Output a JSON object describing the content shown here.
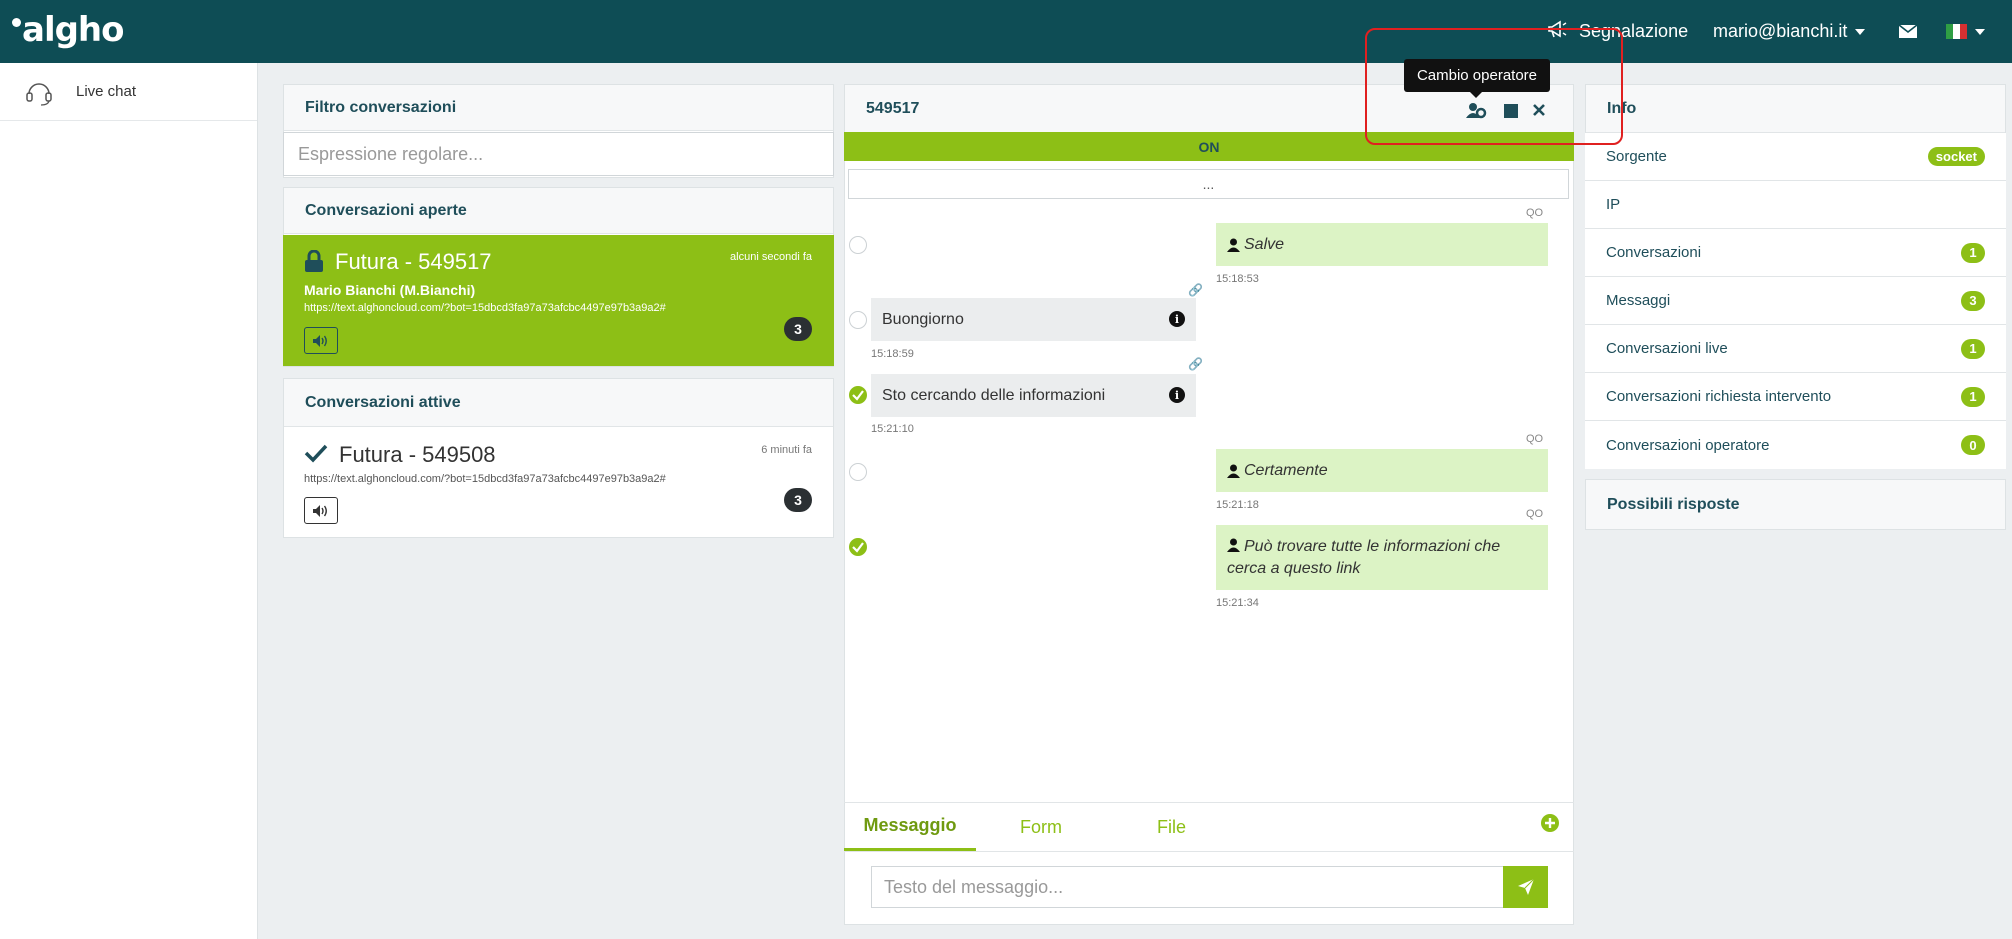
{
  "topbar": {
    "logo": "algho",
    "report_label": "Segnalazione",
    "user_email": "mario@bianchi.it"
  },
  "sidebar": {
    "items": [
      {
        "label": "Live chat",
        "icon": "headset-icon"
      }
    ]
  },
  "filter": {
    "title": "Filtro conversazioni",
    "placeholder": "Espressione regolare..."
  },
  "open_conversations": {
    "title": "Conversazioni aperte",
    "items": [
      {
        "title": "Futura  - 549517",
        "time": "alcuni secondi fa",
        "user": "Mario Bianchi (M.Bianchi)",
        "url": "https://text.alghoncloud.com/?bot=15dbcd3fa97a73afcbc4497e97b3a9a2#",
        "count": "3"
      }
    ]
  },
  "active_conversations": {
    "title": "Conversazioni attive",
    "items": [
      {
        "title": "Futura  - 549508",
        "time": "6 minuti fa",
        "url": "https://text.alghoncloud.com/?bot=15dbcd3fa97a73afcbc4497e97b3a9a2#",
        "count": "3"
      }
    ]
  },
  "chat": {
    "id": "549517",
    "status": "ON",
    "more": "...",
    "tooltip": "Cambio operatore",
    "messages": [
      {
        "side": "operator",
        "sender": "QO",
        "text": "Salve",
        "time": "15:18:53",
        "checked": false
      },
      {
        "side": "user",
        "text": "Buongiorno",
        "time": "15:18:59",
        "checked": false
      },
      {
        "side": "user",
        "text": "Sto cercando delle informazioni",
        "time": "15:21:10",
        "checked": true
      },
      {
        "side": "operator",
        "sender": "QO",
        "text": "Certamente",
        "time": "15:21:18",
        "checked": false
      },
      {
        "side": "operator",
        "sender": "QO",
        "text": "Può trovare tutte le informazioni che cerca a questo link",
        "time": "15:21:34",
        "checked": true
      }
    ],
    "tabs": [
      "Messaggio",
      "Form",
      "File"
    ],
    "active_tab": "Messaggio",
    "input_placeholder": "Testo del messaggio..."
  },
  "info": {
    "title": "Info",
    "rows": [
      {
        "label": "Sorgente",
        "value": "socket"
      },
      {
        "label": "IP",
        "value": ""
      },
      {
        "label": "Conversazioni",
        "value": "1"
      },
      {
        "label": "Messaggi",
        "value": "3"
      },
      {
        "label": "Conversazioni live",
        "value": "1"
      },
      {
        "label": "Conversazioni richiesta intervento",
        "value": "1"
      },
      {
        "label": "Conversazioni operatore",
        "value": "0"
      }
    ],
    "responses_title": "Possibili risposte"
  },
  "colors": {
    "topbar": "#0e4d55",
    "accent": "#8dbf16",
    "heading": "#1f4e5a",
    "operator_bubble": "#dcf3c5",
    "user_bubble": "#ebedee"
  }
}
